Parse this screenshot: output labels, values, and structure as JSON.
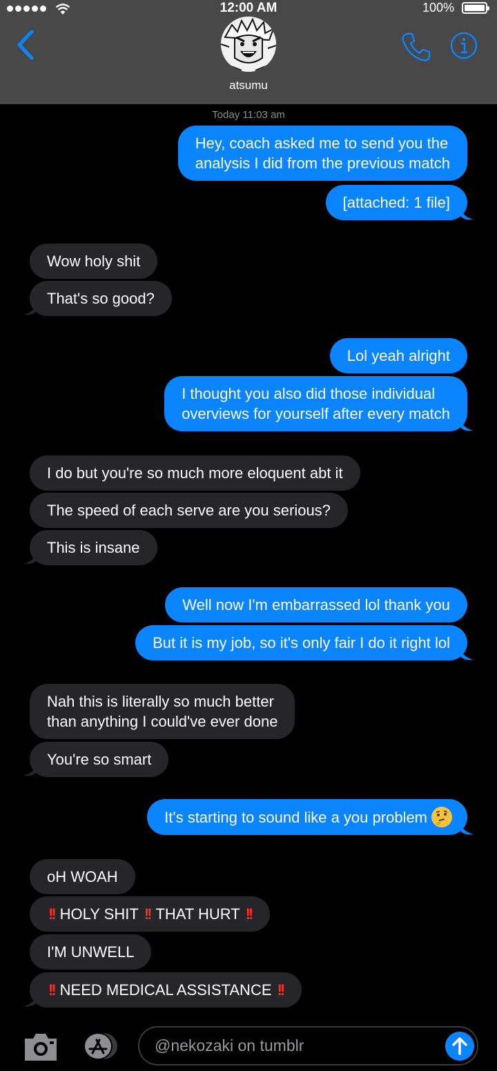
{
  "status_bar": {
    "time": "12:00 AM",
    "battery": "100%"
  },
  "header": {
    "contact_name": "atsumu"
  },
  "timestamp": {
    "day": "Today",
    "time": "11:03 am"
  },
  "messages": [
    {
      "from": "me",
      "lines": [
        "Hey, coach asked me to send you the",
        "analysis I did from the previous match"
      ]
    },
    {
      "from": "me",
      "lines": [
        "[attached: 1 file]"
      ]
    },
    {
      "from": "them",
      "lines": [
        "Wow holy shit"
      ]
    },
    {
      "from": "them",
      "lines": [
        "That's so good?"
      ]
    },
    {
      "from": "me",
      "lines": [
        "Lol yeah alright"
      ]
    },
    {
      "from": "me",
      "lines": [
        "I thought you also did those individual",
        "overviews for yourself after every match"
      ]
    },
    {
      "from": "them",
      "lines": [
        "I do but you're so much more eloquent abt it"
      ]
    },
    {
      "from": "them",
      "lines": [
        "The speed of each serve are you serious?"
      ]
    },
    {
      "from": "them",
      "lines": [
        "This is insane"
      ]
    },
    {
      "from": "me",
      "lines": [
        "Well now I'm embarrassed lol thank you"
      ]
    },
    {
      "from": "me",
      "lines": [
        "But it is my job, so it's only fair I do it right lol"
      ]
    },
    {
      "from": "them",
      "lines": [
        "Nah this is literally so much better",
        "than anything I could've ever done"
      ]
    },
    {
      "from": "them",
      "lines": [
        "You're so smart"
      ]
    },
    {
      "from": "me",
      "lines": [
        "It's starting to sound like a you problem"
      ]
    },
    {
      "from": "them",
      "lines": [
        "oH WOAH"
      ]
    },
    {
      "from": "them",
      "parts": [
        "HOLY SHIT",
        "THAT HURT"
      ]
    },
    {
      "from": "them",
      "lines": [
        "I'M UNWELL"
      ]
    },
    {
      "from": "them",
      "parts": [
        "NEED MEDICAL ASSISTANCE"
      ]
    }
  ],
  "emoji": "thinking-face",
  "toolbar": {
    "input_placeholder": "@nekozaki on tumblr"
  },
  "colors": {
    "sent_bubble": "#0a84ff",
    "received_bubble": "#262628",
    "header_bg": "#484848",
    "accent": "#0a84ff",
    "exclamation": "#ff2a2a"
  }
}
